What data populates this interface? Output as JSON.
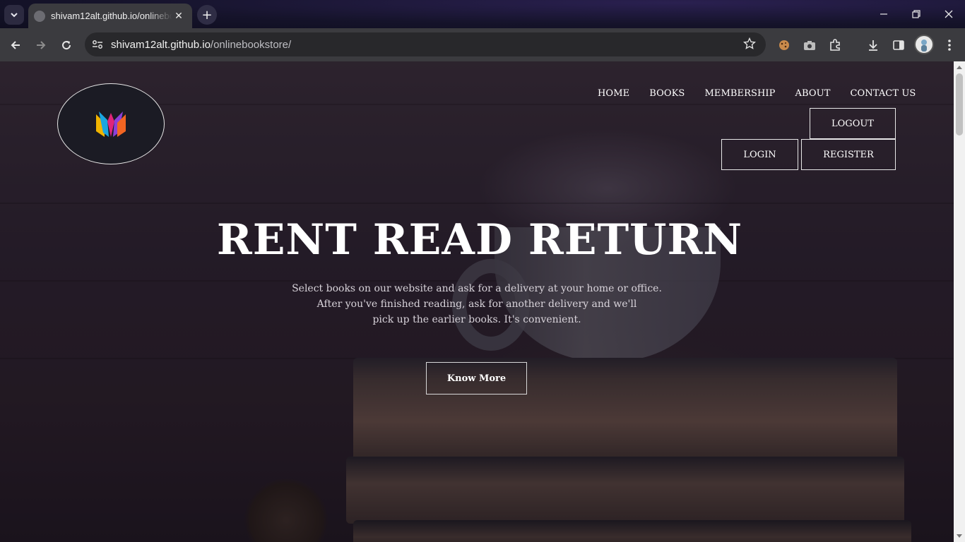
{
  "browser": {
    "tab_title": "shivam12alt.github.io/onlinebookstore/",
    "url_host": "shivam12alt.github.io",
    "url_path": "/onlinebookstore/",
    "icons": [
      "tab-search-icon",
      "close-icon",
      "new-tab-icon",
      "minimize-icon",
      "restore-icon",
      "window-close-icon",
      "back-icon",
      "forward-icon",
      "reload-icon",
      "site-info-icon",
      "bookmark-star-icon",
      "cookie-extension-icon",
      "camera-extension-icon",
      "extensions-puzzle-icon",
      "download-icon",
      "side-panel-icon",
      "profile-avatar",
      "more-menu-icon"
    ]
  },
  "site": {
    "nav": {
      "home": "HOME",
      "books": "BOOKS",
      "membership": "MEMBERSHIP",
      "about": "ABOUT",
      "contact": "CONTACT US"
    },
    "auth": {
      "logout": "LOGOUT",
      "login": "LOGIN",
      "register": "REGISTER"
    },
    "hero": {
      "title": "RENT READ RETURN",
      "line1": "Select books on our website and ask for a delivery at your home or office.",
      "line2": "After you've finished reading, ask for another delivery and we'll",
      "line3": "pick up the earlier books. It's convenient.",
      "cta": "Know More"
    },
    "colors": {
      "text": "#ffffff",
      "border": "#e8e8e8",
      "logo_bg": "#1b1b24"
    }
  }
}
